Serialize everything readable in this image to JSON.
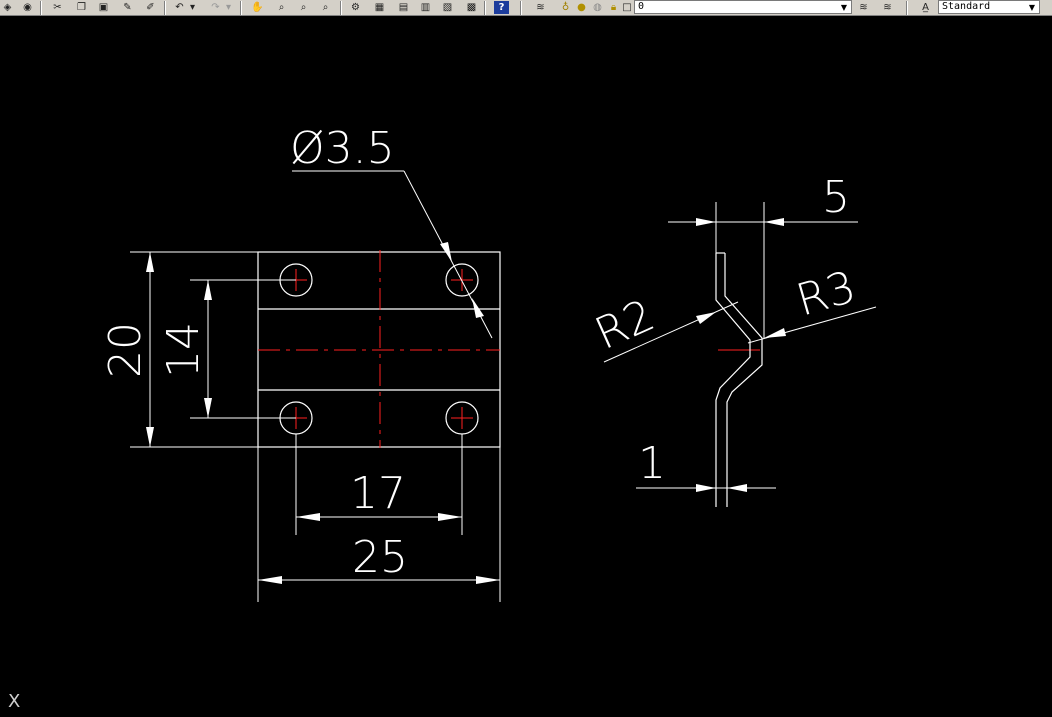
{
  "toolbar": {
    "icons": [
      "layers-icon",
      "globe-icon",
      "cut-icon",
      "copy-icon",
      "paste-icon",
      "brush-icon",
      "match-properties-icon",
      "undo-icon",
      "undo-dropdown-icon",
      "redo-icon",
      "redo-dropdown-icon",
      "pan-icon",
      "zoom-realtime-icon",
      "zoom-window-icon",
      "zoom-previous-icon",
      "properties-icon",
      "design-center-icon",
      "tool-palette-icon",
      "sheet-set-icon",
      "markup-icon",
      "calculator-icon",
      "help-icon",
      "layer-manager-icon",
      "bulb-icon",
      "sun-icon",
      "freeze-icon",
      "lock-icon",
      "color-swatch-icon",
      "layer-previous-icon",
      "layer-state-icon",
      "text-style-icon"
    ],
    "layer_value": "0",
    "style_value": "Standard"
  },
  "drawing": {
    "dim_diameter": "Ø3.5",
    "dim_height_total": "20",
    "dim_height_holes": "14",
    "dim_width_holes": "17",
    "dim_width_total": "25",
    "dim_side_width": "5",
    "dim_radius_inner": "R2",
    "dim_radius_outer": "R3",
    "dim_thickness": "1"
  },
  "colors": {
    "background": "#000000",
    "line": "#ffffff",
    "center_line": "#ff0000",
    "toolbar": "#d4d0c8"
  },
  "ucs_label": "X"
}
